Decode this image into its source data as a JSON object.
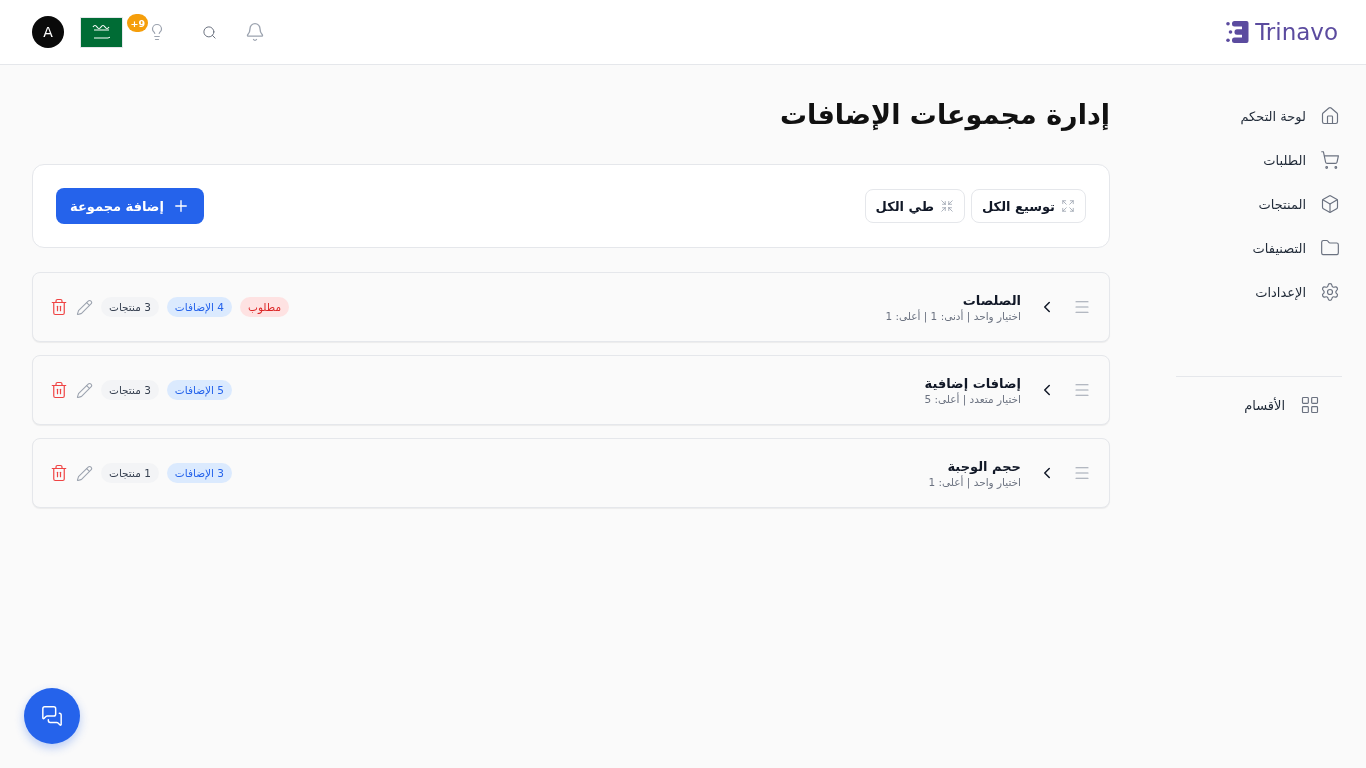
{
  "header": {
    "logo": "Trinavo",
    "notification_badge": "+9",
    "avatar": "A"
  },
  "sidebar": {
    "items": [
      {
        "label": "لوحة التحكم",
        "selected": false
      },
      {
        "label": "الطلبات",
        "selected": false
      },
      {
        "label": "المنتجات",
        "selected": false
      },
      {
        "label": "التصنيفات",
        "selected": false
      },
      {
        "label": "الإعدادات",
        "selected": false
      }
    ],
    "footer_item": {
      "label": "الأقسام"
    }
  },
  "page": {
    "title": "إدارة مجموعات الإضافات"
  },
  "toolbar": {
    "buttons": [
      {
        "label": "توسيع الكل"
      },
      {
        "label": "طي الكل"
      }
    ],
    "add_button": {
      "label": "إضافة مجموعة"
    }
  },
  "groups": [
    {
      "title": "الصلصات",
      "subtitle": "اختيار واحد | أدنى: 1 | أعلى: 1",
      "expanded": false,
      "badges": [
        {
          "kind": "required",
          "text": "مطلوب"
        },
        {
          "kind": "addons",
          "text": "4 الإضافات"
        },
        {
          "kind": "products",
          "text": "3 منتجات"
        }
      ]
    },
    {
      "title": "إضافات إضافية",
      "subtitle": "اختيار متعدد | أعلى: 5",
      "expanded": false,
      "badges": [
        {
          "kind": "addons",
          "text": "5 الإضافات"
        },
        {
          "kind": "products",
          "text": "3 منتجات"
        }
      ]
    },
    {
      "title": "حجم الوجبة",
      "subtitle": "اختيار واحد | أعلى: 1",
      "expanded": false,
      "badges": [
        {
          "kind": "addons",
          "text": "3 الإضافات"
        },
        {
          "kind": "products",
          "text": "1 منتجات"
        }
      ]
    }
  ]
}
